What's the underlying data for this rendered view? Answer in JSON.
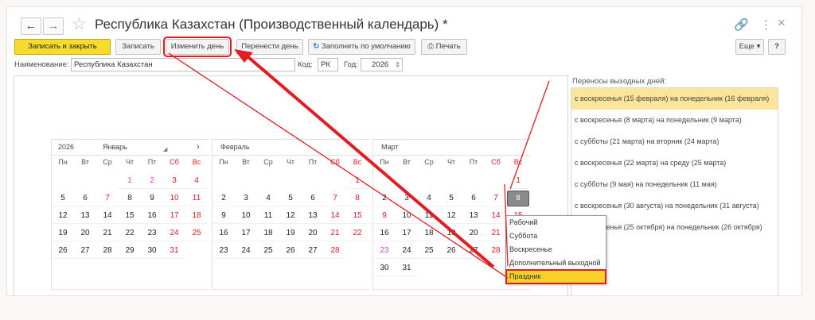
{
  "window": {
    "title": "Республика Казахстан (Производственный календарь) *"
  },
  "nav": {
    "back": "←",
    "forward": "→",
    "star": "☆",
    "link": "🔗",
    "menu": "⋮",
    "close": "×"
  },
  "toolbar": {
    "save_close": "Записать и закрыть",
    "save": "Записать",
    "change_day": "Изменить день",
    "move_day": "Перенести день",
    "fill_default": "Заполнить по умолчанию",
    "print": "Печать",
    "more": "Еще ▾",
    "help": "?"
  },
  "form": {
    "name_label": "Наименование:",
    "name_value": "Республика Казахстан",
    "code_label": "Код:",
    "code_value": "РК",
    "year_label": "Год:",
    "year_value": "2026"
  },
  "calendar": {
    "weekdays": [
      "Пн",
      "Вт",
      "Ср",
      "Чт",
      "Пт",
      "Сб",
      "Вс"
    ],
    "months": [
      {
        "year": "2026",
        "name": "Январь",
        "start": 3,
        "days": 31,
        "pre": [
          1,
          2
        ],
        "holidays": [
          7
        ]
      },
      {
        "name": "Февраль",
        "start": 6,
        "days": 28,
        "pre": [],
        "holidays": []
      },
      {
        "name": "Март",
        "start": 6,
        "days": 31,
        "pre": [
          23
        ],
        "holidays": [
          8,
          9
        ],
        "current": 8
      }
    ]
  },
  "transfers": {
    "title": "Переносы выходных дней:",
    "items": [
      "с воскресенья (15 февраля) на понедельник (16 февраля)",
      "с воскресенья (8 марта) на понедельник (9 марта)",
      "с субботы (21 марта) на вторник (24 марта)",
      "с воскресенья (22 марта) на среду (25 марта)",
      "с субботы (9 мая) на понедельник (11 мая)",
      "с воскресенья (30 августа) на понедельник (31 августа)",
      "с воскресенья (25 октября) на понедельник (26 октября)"
    ]
  },
  "day_type_menu": {
    "items": [
      "Рабочий",
      "Суббота",
      "Воскресенье",
      "Дополнительный выходной",
      "Праздник"
    ],
    "selected": 4
  },
  "colors": {
    "accent": "#f7dc2f",
    "highlight": "#e31b23",
    "weekend": "#e31b23",
    "preholiday": "#c84cc9",
    "selected_row": "#fbe59a"
  }
}
